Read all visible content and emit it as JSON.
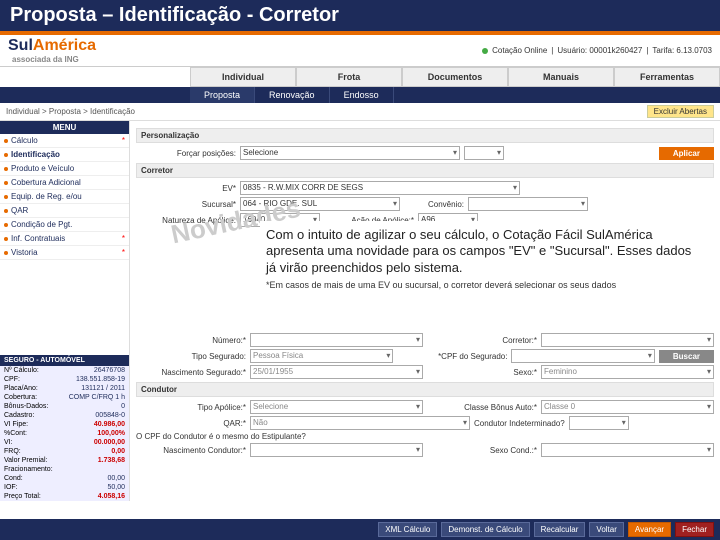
{
  "title": "Proposta – Identificação - Corretor",
  "logo": {
    "brand1": "Sul",
    "brand2": "América",
    "sub": "associada da ING"
  },
  "status": {
    "online": "Cotação Online",
    "user": "Usuário: 00001k260427",
    "date": "Tarifa: 6.13.0703"
  },
  "nav": {
    "tabs": [
      "Individual",
      "Frota",
      "Documentos",
      "Manuais",
      "Ferramentas"
    ]
  },
  "subnav": {
    "items": [
      "Proposta",
      "Renovação",
      "Endosso"
    ]
  },
  "breadcrumb": "Individual > Proposta > Identificação",
  "exit_btn": "Excluir Abertas",
  "menu": {
    "header": "MENU",
    "items": [
      {
        "label": "Cálculo",
        "ast": true
      },
      {
        "label": "Identificação",
        "current": true
      },
      {
        "label": "Produto e Veículo"
      },
      {
        "label": "Cobertura Adicional"
      },
      {
        "label": "Equip. de Reg. e/ou"
      },
      {
        "label": "QAR"
      },
      {
        "label": "Condição de Pgt."
      },
      {
        "label": "Inf. Contratuais",
        "ast": true
      },
      {
        "label": "Vistoria",
        "ast": true
      }
    ]
  },
  "seguro": {
    "header": "SEGURO - AUTOMÓVEL",
    "rows": [
      {
        "k": "Nº Cálculo:",
        "v": "26476708"
      },
      {
        "k": "CPF:",
        "v": "138.551.858-19"
      },
      {
        "k": "Placa/Ano:",
        "v": "131121 / 2011"
      },
      {
        "k": "Cobertura:",
        "v": "COMP C/FRQ 1 h"
      },
      {
        "k": "Bônus-Dados:",
        "v": "0"
      },
      {
        "k": "Cadastro:",
        "v": "005848-0"
      },
      {
        "k": "VI Fipe:",
        "v": "40.986,00",
        "red": true
      },
      {
        "k": "%Cont:",
        "v": "100,00%",
        "red": true
      },
      {
        "k": "VI:",
        "v": "00.000,00",
        "red": true
      },
      {
        "k": "FRQ:",
        "v": "0,00",
        "red": true
      },
      {
        "k": "Valor Premial:",
        "v": "1.738,68",
        "red": true
      },
      {
        "k": "Fracionamento:",
        "v": ""
      },
      {
        "k": "Cond:",
        "v": "00,00"
      },
      {
        "k": "IOF:",
        "v": "50,00"
      },
      {
        "k": "Preço Total:",
        "v": "4.058,16",
        "red": true
      }
    ]
  },
  "sections": {
    "personalizacao": "Personalização",
    "forcar": "Forçar posições:",
    "selecione": "Selecione",
    "aplicar": "Aplicar",
    "corretor": "Corretor",
    "ev_label": "EV*",
    "ev_val": "0835 - R.W.MIX CORR DE SEGS",
    "sucursal_label": "Sucursal*",
    "sucursal_val": "064 - RIO GDE. SUL",
    "convenio": "Convênio:",
    "natureza": "Natureza de Apólice:",
    "nat_val": "16040",
    "acao": "Ação de Apólice:*",
    "acao_val": "A96"
  },
  "novidades": "Novidades",
  "callout": {
    "text": "Com o intuito de agilizar o seu cálculo, o Cotação Fácil SulAmérica apresenta uma novidade para os campos \"EV\" e \"Sucursal\". Esses dados já virão preenchidos pelo sistema.",
    "note": "*Em casos de mais de uma EV ou sucursal, o corretor deverá selecionar os seus dados"
  },
  "lower": {
    "numero": "Número:*",
    "corretor": "Corretor:*",
    "tipo_seg": "Tipo Segurado:",
    "tipo_seg_v": "Pessoa Física",
    "cpf_seg": "*CPF do Segurado:",
    "srch": "Buscar",
    "nasc": "Nascimento Segurado:*",
    "nasc_v": "25/01/1955",
    "sexo": "Sexo:*",
    "sexo_v": "Feminino",
    "condutor": "Condutor",
    "tipo_apolice": "Tipo Apólice:*",
    "tipo_ap_v": "Selecione",
    "classe": "Classe Bônus Auto:*",
    "classe_v": "Classe 0",
    "qar": "QAR:*",
    "qar_v": "Não",
    "indet": "Condutor Indeterminado?",
    "cpf_note": "O CPF do Condutor é o mesmo do Estipulante?",
    "nasc_cond": "Nascimento Condutor:*",
    "sexo_cond": "Sexo Cond.:*"
  },
  "footer": {
    "btns": [
      "XML Cálculo",
      "Demonst. de Cálculo",
      "Recalcular",
      "Voltar",
      "Avançar",
      "Fechar"
    ]
  }
}
